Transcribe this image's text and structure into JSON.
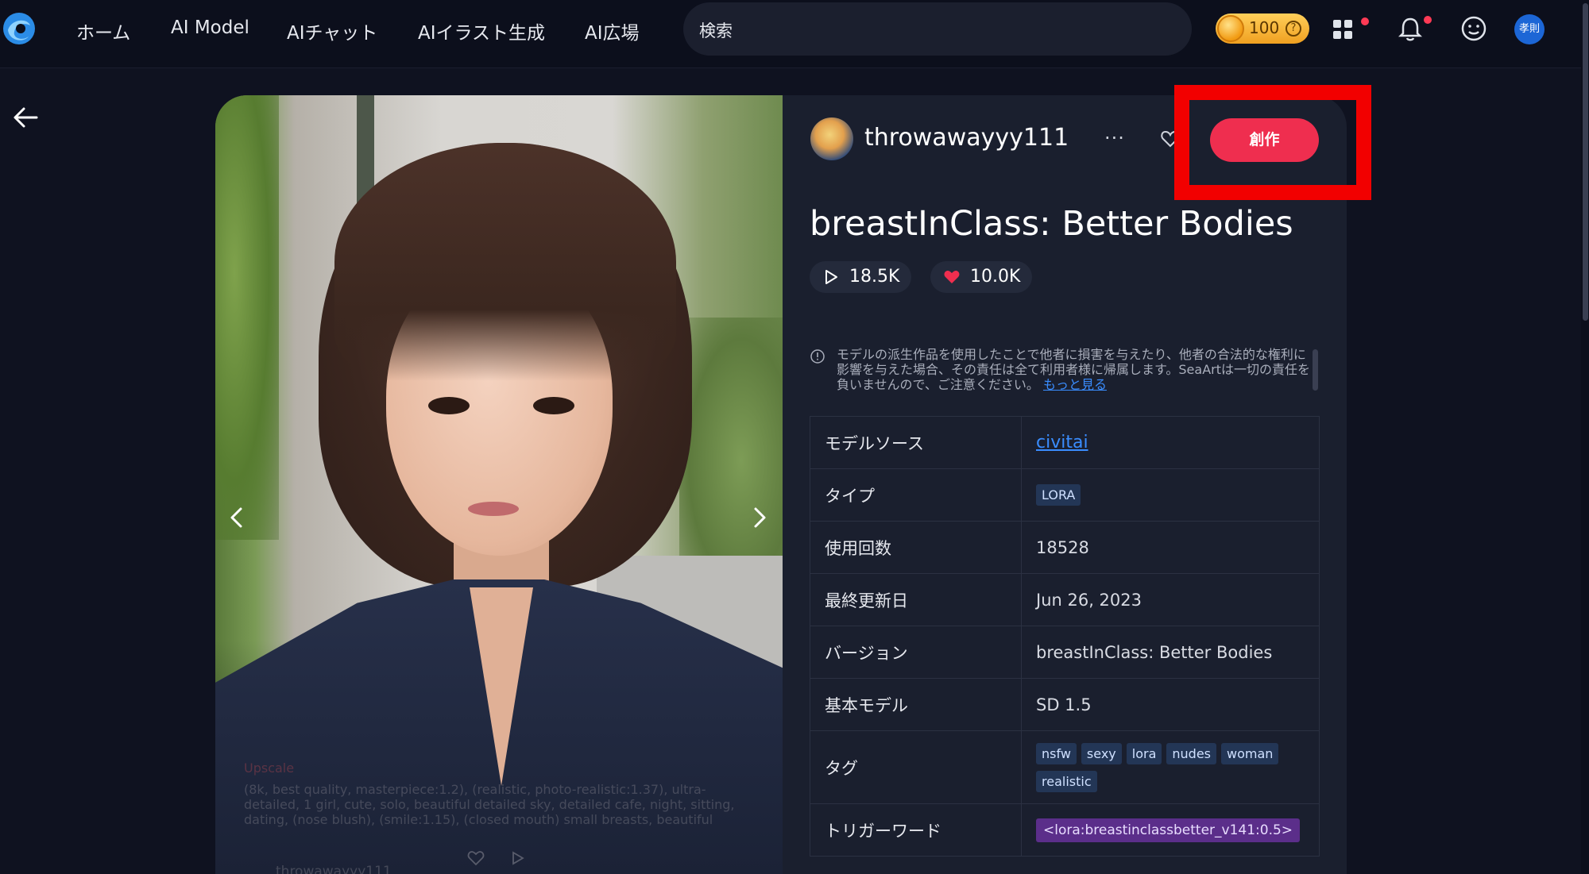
{
  "nav": {
    "items": [
      "ホーム",
      "AI Model",
      "AIチャット",
      "AIイラスト生成",
      "AI広場"
    ],
    "search_placeholder": "検索",
    "coins": "100",
    "coin_help": "?",
    "user_avatar_text": "孝則"
  },
  "image": {
    "caption_tag": "Upscale",
    "caption_prompt": "(8k, best quality, masterpiece:1.2), (realistic, photo-realistic:1.37), ultra-detailed, 1 girl, cute, solo, beautiful detailed sky, detailed cafe, night, sitting, dating, (nose blush), (smile:1.15), (closed mouth) small breasts, beautiful",
    "caption_author": "throwawayyy111"
  },
  "model": {
    "author": "throwawayyy111",
    "more": "···",
    "create_label": "創作",
    "title": "breastInClass: Better Bodies",
    "runs": "18.5K",
    "likes": "10.0K",
    "disclaimer": "モデルの派生作品を使用したことで他者に損害を与えたり、他者の合法的な権利に影響を与えた場合、その責任は全て利用者様に帰属します。SeaArtは一切の責任を負いませんので、ご注意ください。",
    "disclaimer_link": "もっと見る"
  },
  "specs": {
    "source_label": "モデルソース",
    "source_value": "civitai",
    "type_label": "タイプ",
    "type_value": "LORA",
    "uses_label": "使用回数",
    "uses_value": "18528",
    "updated_label": "最終更新日",
    "updated_value": "Jun 26, 2023",
    "version_label": "バージョン",
    "version_value": "breastInClass: Better Bodies",
    "base_label": "基本モデル",
    "base_value": "SD 1.5",
    "tags_label": "タグ",
    "tags": [
      "nsfw",
      "sexy",
      "lora",
      "nudes",
      "woman",
      "realistic"
    ],
    "trigger_label": "トリガーワード",
    "trigger_value": "<lora:breastinclassbetter_v141:0.5>"
  },
  "colors": {
    "accent": "#ef2e4f",
    "highlight": "#f20000",
    "link": "#3a8dff",
    "background": "#0f1220",
    "panel": "#1a1f2e"
  },
  "icons": [
    "seaart-logo-icon",
    "coin-icon",
    "help-icon",
    "apps-grid-icon",
    "bell-icon",
    "smiley-icon",
    "back-arrow-icon",
    "chevron-left-icon",
    "chevron-right-icon",
    "heart-outline-icon",
    "play-icon",
    "heart-icon",
    "info-icon"
  ]
}
